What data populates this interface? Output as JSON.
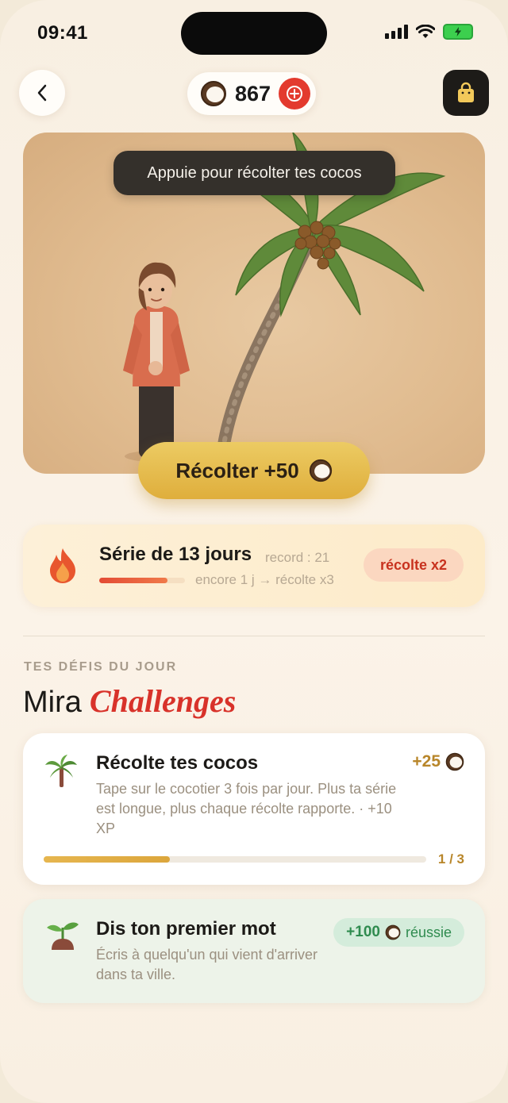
{
  "status_bar": {
    "time": "09:41"
  },
  "header": {
    "coin_balance": "867",
    "icons": {
      "back": "chevron-left-icon",
      "coin": "coconut-icon",
      "add": "plus-circle-icon",
      "shop": "shopping-bag-icon"
    }
  },
  "hero": {
    "tooltip": "Appuie pour récolter tes cocos",
    "harvest_label": "Récolter +50"
  },
  "streak": {
    "title": "Série de 13 jours",
    "record": "record : 21",
    "next": "encore 1 j → récolte x3",
    "multiplier": "récolte x2",
    "progress": 0.8,
    "colors": {
      "fill": "#e34b35",
      "badge_bg": "#fbd7c0",
      "badge_text": "#c8321e"
    }
  },
  "challenges_section": {
    "kicker": "TES DÉFIS DU JOUR",
    "title_plain": "Mira",
    "title_accent": "Challenges",
    "accent_color": "#d8322a"
  },
  "challenges": [
    {
      "icon": "palm-tree-icon",
      "title": "Récolte tes cocos",
      "description": "Tape sur le cocotier 3 fois par jour. Plus ta série est longue, plus chaque récolte rapporte. · +10 XP",
      "reward": "+25",
      "progress_text": "1 / 3",
      "progress": 0.33
    },
    {
      "icon": "sprout-icon",
      "title": "Dis ton premier mot",
      "description": "Écris à quelqu'un qui vient d'arriver dans ta ville.",
      "reward": "+100",
      "status": "réussie"
    }
  ]
}
